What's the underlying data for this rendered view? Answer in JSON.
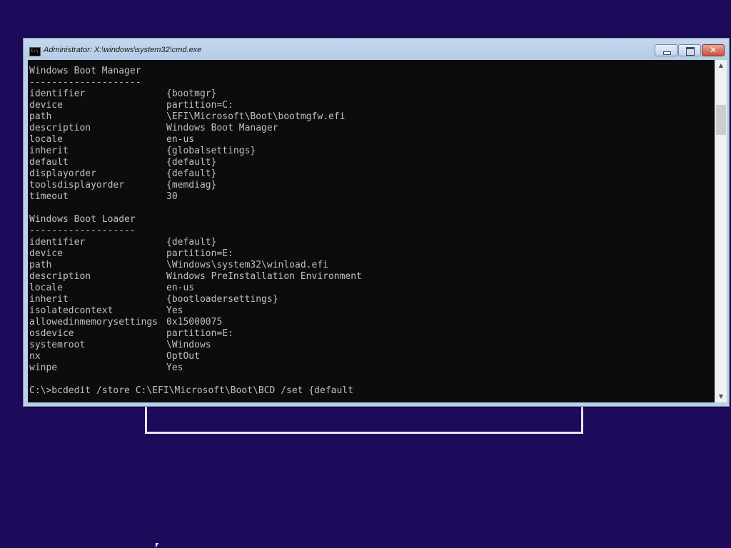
{
  "window": {
    "title": "Administrator: X:\\windows\\system32\\cmd.exe",
    "icon_label": "C:\\",
    "minimize_icon": "minimize-icon",
    "maximize_icon": "maximize-icon",
    "close_icon": "close-icon"
  },
  "console": {
    "boot_manager_header": "Windows Boot Manager",
    "boot_manager_underline": "--------------------",
    "boot_manager_entries": [
      {
        "key": "identifier",
        "value": "{bootmgr}"
      },
      {
        "key": "device",
        "value": "partition=C:"
      },
      {
        "key": "path",
        "value": "\\EFI\\Microsoft\\Boot\\bootmgfw.efi"
      },
      {
        "key": "description",
        "value": "Windows Boot Manager"
      },
      {
        "key": "locale",
        "value": "en-us"
      },
      {
        "key": "inherit",
        "value": "{globalsettings}"
      },
      {
        "key": "default",
        "value": "{default}"
      },
      {
        "key": "displayorder",
        "value": "{default}"
      },
      {
        "key": "toolsdisplayorder",
        "value": "{memdiag}"
      },
      {
        "key": "timeout",
        "value": "30"
      }
    ],
    "boot_loader_header": "Windows Boot Loader",
    "boot_loader_underline": "-------------------",
    "boot_loader_entries": [
      {
        "key": "identifier",
        "value": "{default}"
      },
      {
        "key": "device",
        "value": "partition=E:"
      },
      {
        "key": "path",
        "value": "\\Windows\\system32\\winload.efi"
      },
      {
        "key": "description",
        "value": "Windows PreInstallation Environment"
      },
      {
        "key": "locale",
        "value": "en-us"
      },
      {
        "key": "inherit",
        "value": "{bootloadersettings}"
      },
      {
        "key": "isolatedcontext",
        "value": "Yes"
      },
      {
        "key": "allowedinmemorysettings",
        "value": "0x15000075"
      },
      {
        "key": "osdevice",
        "value": "partition=E:"
      },
      {
        "key": "systemroot",
        "value": "\\Windows"
      },
      {
        "key": "nx",
        "value": "OptOut"
      },
      {
        "key": "winpe",
        "value": "Yes"
      }
    ],
    "prompt_line": "C:\\>bcdedit /store C:\\EFI\\Microsoft\\Boot\\BCD /set {default"
  },
  "scrollbar": {
    "up_icon": "scroll-up-arrow-icon",
    "down_icon": "scroll-down-arrow-icon",
    "up_glyph": "▲",
    "down_glyph": "▼"
  },
  "colors": {
    "desktop_background": "#1e0a5a",
    "console_background": "#0c0c0c",
    "console_text": "#c0c0c0",
    "title_bar": "#b9d1ea",
    "close_button": "#c9513a"
  }
}
